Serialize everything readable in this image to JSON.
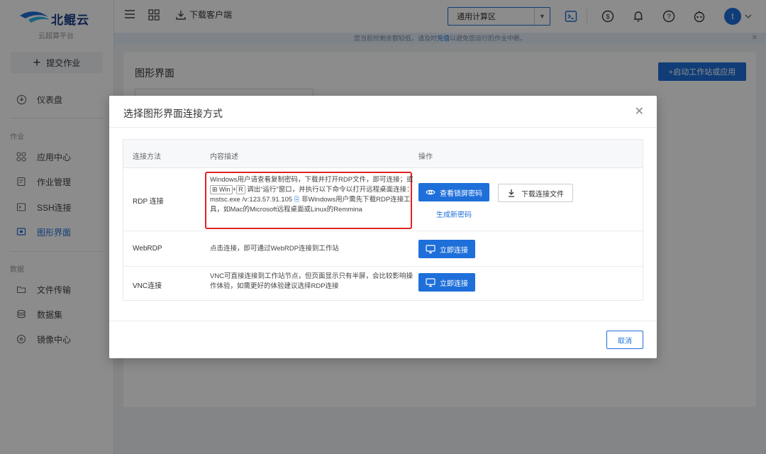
{
  "app": {
    "brand": "北鲲云",
    "brand_sub": "云超算平台",
    "submit_label": "提交作业",
    "accent": "#1e6fd9"
  },
  "sidebar": {
    "dashboard": "仪表盘",
    "section_job": "作业",
    "section_data": "数据",
    "items_job": [
      {
        "label": "应用中心",
        "icon": "grid-icon"
      },
      {
        "label": "作业管理",
        "icon": "document-icon"
      },
      {
        "label": "SSH连接",
        "icon": "terminal-icon"
      },
      {
        "label": "图形界面",
        "icon": "monitor-icon",
        "active": true
      }
    ],
    "items_data": [
      {
        "label": "文件传输",
        "icon": "folder-icon"
      },
      {
        "label": "数据集",
        "icon": "database-icon"
      },
      {
        "label": "镜像中心",
        "icon": "disc-icon"
      }
    ]
  },
  "header": {
    "download_client": "下载客户端",
    "zone_select": "通用计算区",
    "avatar_letter": "t"
  },
  "notice": {
    "text_before": "您当前所剩余额较低，请及时",
    "link": "充值",
    "text_after": "以避免您运行的作业中断。"
  },
  "main": {
    "title": "图形界面",
    "launch_button": "+启动工作站或应用"
  },
  "modal": {
    "title": "选择图形界面连接方式",
    "columns": [
      "连接方法",
      "内容描述",
      "操作"
    ],
    "rows": [
      {
        "method": "RDP 连接",
        "desc_part1": "Windows用户请查看复制密码，下载并打开RDP文件，即可连接；或",
        "key_win": "⊞ Win",
        "key_plus": "+",
        "key_r": "R",
        "desc_part2": "调出“运行”窗口，并执行以下命令以打开远程桌面连接：mstsc.exe /v:123.57.91.105",
        "desc_part3": "非Windows用户需先下载RDP连接工具，如Mac的Microsoft远程桌面或Linux的Remmina",
        "btn_view_password": "查看锁屏密码",
        "btn_download_file": "下载连接文件",
        "link_new_password": "生成新密码"
      },
      {
        "method": "WebRDP",
        "desc": "点击连接，即可通过WebRDP连接到工作站",
        "btn_connect": "立即连接"
      },
      {
        "method": "VNC连接",
        "desc": "VNC可直接连接到工作站节点，但页面显示只有半屏，会比较影响操作体验，如需更好的体验建议选择RDP连接",
        "btn_connect": "立即连接"
      }
    ],
    "cancel": "取消"
  }
}
